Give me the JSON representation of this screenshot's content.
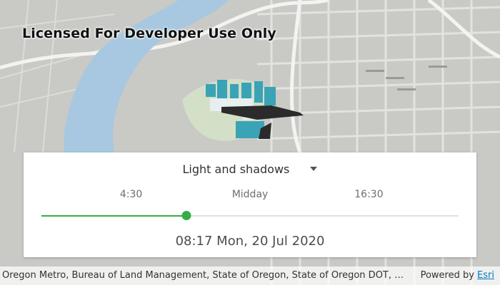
{
  "map": {
    "watermark": "Licensed For Developer Use Only",
    "colors": {
      "land": "#c9c9c6",
      "water": "#a7c8e0",
      "park": "#d4dfc8",
      "buildings": "#3aa3b5",
      "shadow": "#2b2b2b"
    }
  },
  "panel": {
    "mode_label": "Light and shadows",
    "mode_icon": "chevron-down-icon",
    "ticks": [
      {
        "label": "4:30",
        "fraction": 0.215
      },
      {
        "label": "Midday",
        "fraction": 0.5
      },
      {
        "label": "16:30",
        "fraction": 0.785
      }
    ],
    "slider": {
      "value_fraction": 0.347,
      "color": "#35ac46"
    },
    "datetime": "08:17 Mon, 20 Jul 2020"
  },
  "attribution": {
    "sources": "Oregon Metro, Bureau of Land Management, State of Oregon, State of Oregon DOT, Esri, HERE, Garmin",
    "powered_by_prefix": "Powered by ",
    "powered_by_link": "Esri"
  }
}
